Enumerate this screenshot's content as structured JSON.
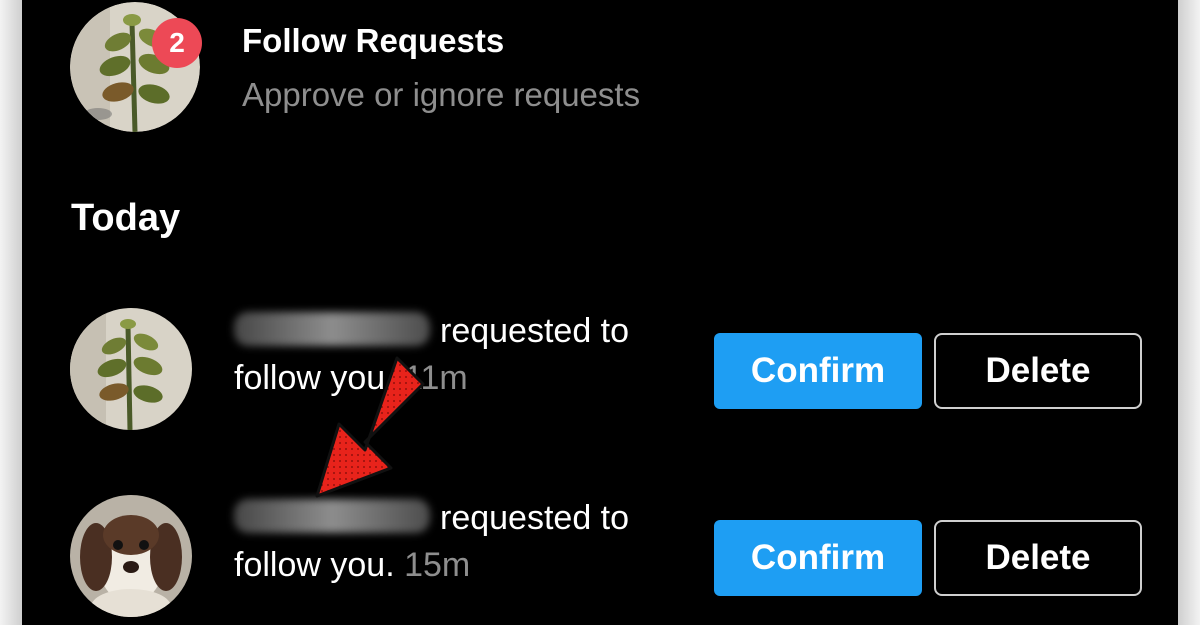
{
  "follow_requests": {
    "badge_count": "2",
    "title": "Follow Requests",
    "subtitle": "Approve or ignore requests"
  },
  "section_title": "Today",
  "notifications": [
    {
      "text": "requested to",
      "text_line2": "follow you.",
      "time": "11m",
      "confirm_label": "Confirm",
      "delete_label": "Delete"
    },
    {
      "text": "requested to",
      "text_line2": "follow you.",
      "time": "15m",
      "confirm_label": "Confirm",
      "delete_label": "Delete"
    }
  ],
  "colors": {
    "background": "#000000",
    "confirm_button": "#1e9ef3",
    "badge": "#ed4956",
    "secondary_text": "#8e8e8e",
    "annotation_arrow": "#e8231b"
  },
  "icons": {
    "annotation": "red-arrow-icon"
  }
}
